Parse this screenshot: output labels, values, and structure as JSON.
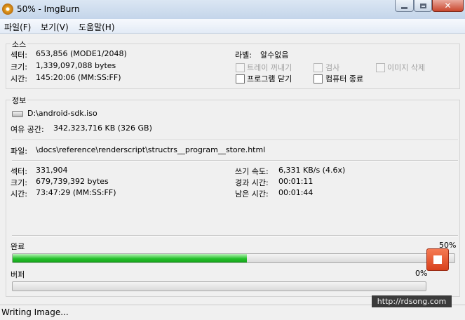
{
  "window": {
    "title": "50% - ImgBurn"
  },
  "menu": {
    "file": "파일(F)",
    "view": "보기(V)",
    "help": "도움말(H)"
  },
  "source": {
    "title": "소스",
    "sector_label": "섹터:",
    "sector_value": "653,856 (MODE1/2048)",
    "size_label": "크기:",
    "size_value": "1,339,097,088 bytes",
    "time_label": "시간:",
    "time_value": "145:20:06 (MM:SS:FF)",
    "volume_label": "라벨:",
    "volume_value": "알수없음",
    "eject_tray": "트레이 꺼내기",
    "verify": "검사",
    "delete_image": "이미지 삭제",
    "close_program": "프로그램 닫기",
    "shutdown": "컴퓨터 종료"
  },
  "info": {
    "title": "정보",
    "path": "D:\\android-sdk.iso",
    "free_label": "여유 공간:",
    "free_value": "342,323,716 KB  (326 GB)",
    "file_label": "파일:",
    "file_value": "\\docs\\reference\\renderscript\\structrs__program__store.html",
    "sector_label": "섹터:",
    "sector_value": "331,904",
    "size_label": "크기:",
    "size_value": "679,739,392 bytes",
    "time_label": "시간:",
    "time_value": "73:47:29 (MM:SS:FF)",
    "write_speed_label": "쓰기 속도:",
    "write_speed_value": "6,331 KB/s (4.6x)",
    "elapsed_label": "경과 시간:",
    "elapsed_value": "00:01:11",
    "remaining_label": "남은 시간:",
    "remaining_value": "00:01:44",
    "complete_label": "완료",
    "complete_percent": "50%",
    "complete_fraction": 0.53,
    "buffer_label": "버퍼",
    "buffer_percent": "0%",
    "buffer_fraction": 0
  },
  "status": {
    "text": "Writing Image..."
  },
  "watermark": "http://rdsong.com"
}
